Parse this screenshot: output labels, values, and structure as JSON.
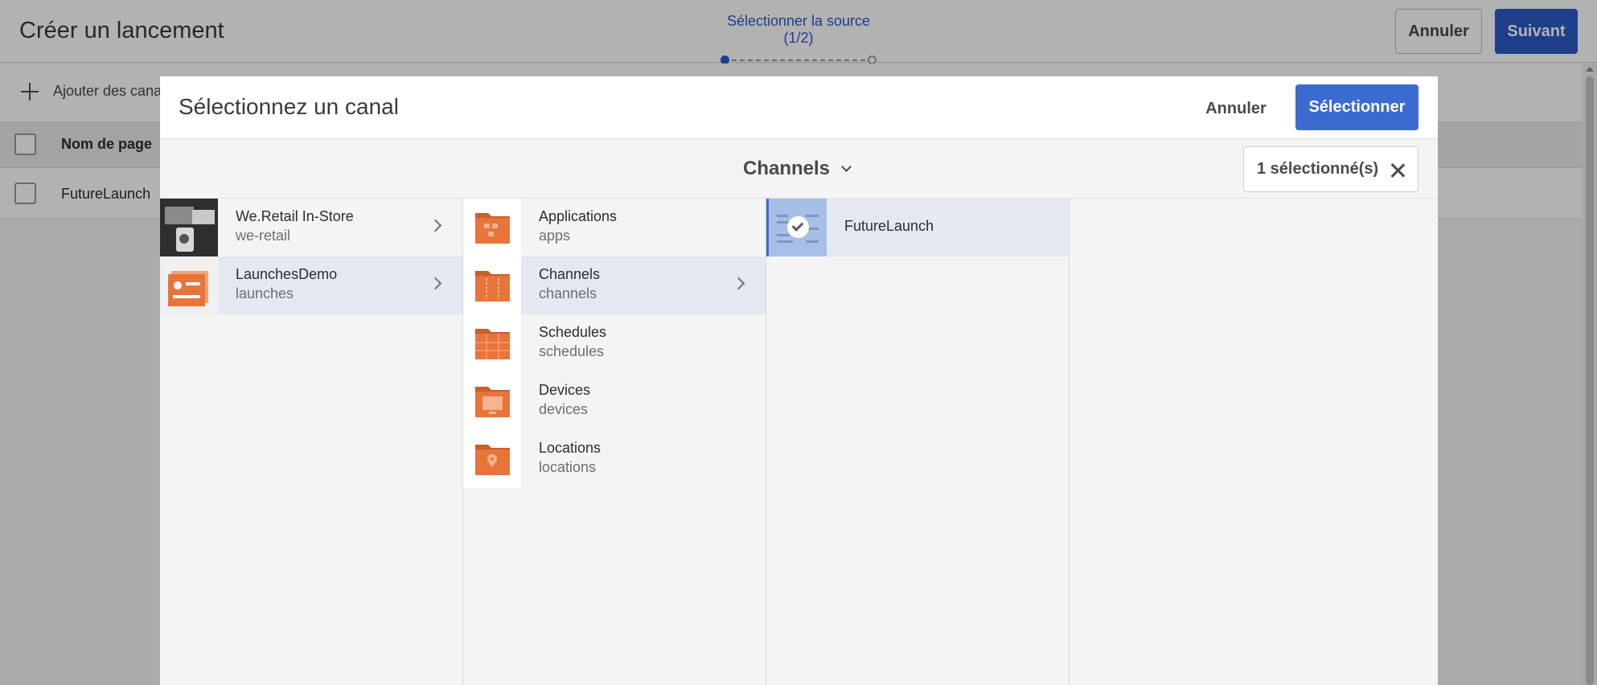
{
  "page": {
    "title": "Créer un lancement",
    "wizard_step": "Sélectionner la source (1/2)",
    "cancel_label": "Annuler",
    "next_label": "Suivant",
    "add_channels_label": "Ajouter des canaux",
    "table_header_name": "Nom de page",
    "table_rows": [
      "FutureLaunch"
    ]
  },
  "dialog": {
    "title": "Sélectionnez un canal",
    "cancel_label": "Annuler",
    "select_label": "Sélectionner",
    "breadcrumb": "Channels",
    "selected_count": "1 sélectionné(s)",
    "columns": [
      {
        "items": [
          {
            "title": "We.Retail In-Store",
            "subtitle": "we-retail",
            "has_children": true,
            "selected": false,
            "icon": "photo-thumbnail"
          },
          {
            "title": "LaunchesDemo",
            "subtitle": "launches",
            "has_children": true,
            "selected": true,
            "icon": "site-thumbnail"
          }
        ]
      },
      {
        "items": [
          {
            "title": "Applications",
            "subtitle": "apps",
            "has_children": false,
            "selected": false,
            "icon": "folder-apps-icon"
          },
          {
            "title": "Channels",
            "subtitle": "channels",
            "has_children": true,
            "selected": true,
            "icon": "folder-channels-icon"
          },
          {
            "title": "Schedules",
            "subtitle": "schedules",
            "has_children": false,
            "selected": false,
            "icon": "folder-schedules-icon"
          },
          {
            "title": "Devices",
            "subtitle": "devices",
            "has_children": false,
            "selected": false,
            "icon": "folder-devices-icon"
          },
          {
            "title": "Locations",
            "subtitle": "locations",
            "has_children": false,
            "selected": false,
            "icon": "folder-locations-icon"
          }
        ]
      },
      {
        "items": [
          {
            "title": "FutureLaunch",
            "checked": true,
            "icon": "check-icon"
          }
        ]
      }
    ]
  },
  "colors": {
    "accent": "#3c6bd0",
    "folder_orange": "#e8743b",
    "selected_row": "#e4e8f0"
  }
}
